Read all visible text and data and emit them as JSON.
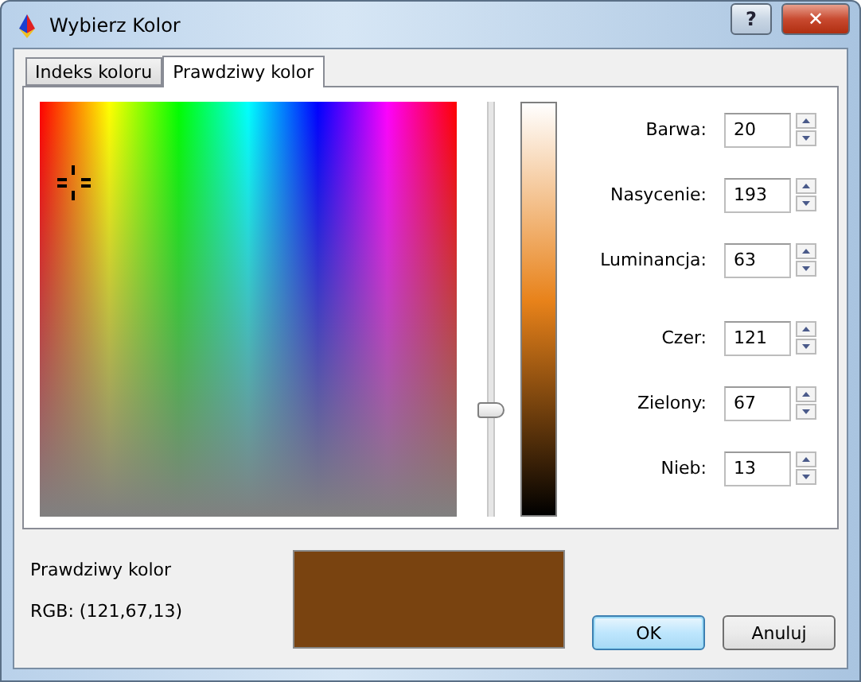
{
  "window": {
    "title": "Wybierz Kolor",
    "help_button": "?",
    "close_button": "✕"
  },
  "tabs": [
    {
      "label": "Indeks koloru",
      "selected": false
    },
    {
      "label": "Prawdziwy kolor",
      "selected": true
    }
  ],
  "luminance_slider": {
    "level": 0.26
  },
  "field_groups": [
    [
      {
        "label": "Barwa:",
        "value": "20"
      },
      {
        "label": "Nasycenie:",
        "value": "193"
      },
      {
        "label": "Luminancja:",
        "value": "63"
      }
    ],
    [
      {
        "label": "Czer:",
        "value": "121"
      },
      {
        "label": "Zielony:",
        "value": "67"
      },
      {
        "label": "Nieb:",
        "value": "13"
      }
    ]
  ],
  "preview": {
    "title": "Prawdziwy kolor",
    "rgb_text": "RGB: (121,67,13)",
    "color": "#794310"
  },
  "buttons": [
    {
      "label": "OK",
      "default": true
    },
    {
      "label": "Anuluj",
      "default": false
    }
  ]
}
